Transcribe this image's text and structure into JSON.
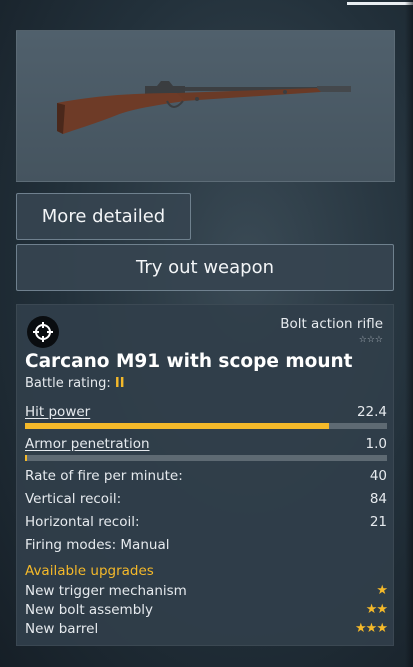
{
  "weapon": {
    "class": "Bolt action rifle",
    "class_stars": "☆☆☆",
    "name": "Carcano M91 with scope mount",
    "battle_rating_label": "Battle rating:",
    "battle_rating": "II"
  },
  "buttons": {
    "more_detailed": "More detailed",
    "try_out": "Try out weapon"
  },
  "stats": [
    {
      "label": "Hit power",
      "value": "22.4",
      "fraction": 0.84
    },
    {
      "label": "Armor penetration",
      "value": "1.0",
      "fraction": 0.005
    }
  ],
  "specs": [
    {
      "label": "Rate of fire per minute:",
      "value": "40"
    },
    {
      "label": "Vertical recoil:",
      "value": "84"
    },
    {
      "label": "Horizontal recoil:",
      "value": "21"
    },
    {
      "label": "Firing modes: Manual",
      "value": ""
    }
  ],
  "upgrades": {
    "heading": "Available upgrades",
    "items": [
      {
        "label": "New trigger mechanism",
        "stars": "★"
      },
      {
        "label": "New bolt assembly",
        "stars": "★★"
      },
      {
        "label": "New barrel",
        "stars": "★★★"
      }
    ]
  },
  "colors": {
    "accent": "#f4b92a",
    "panel": "#303e4a"
  },
  "icons": {
    "class_icon": "crosshair-icon"
  }
}
